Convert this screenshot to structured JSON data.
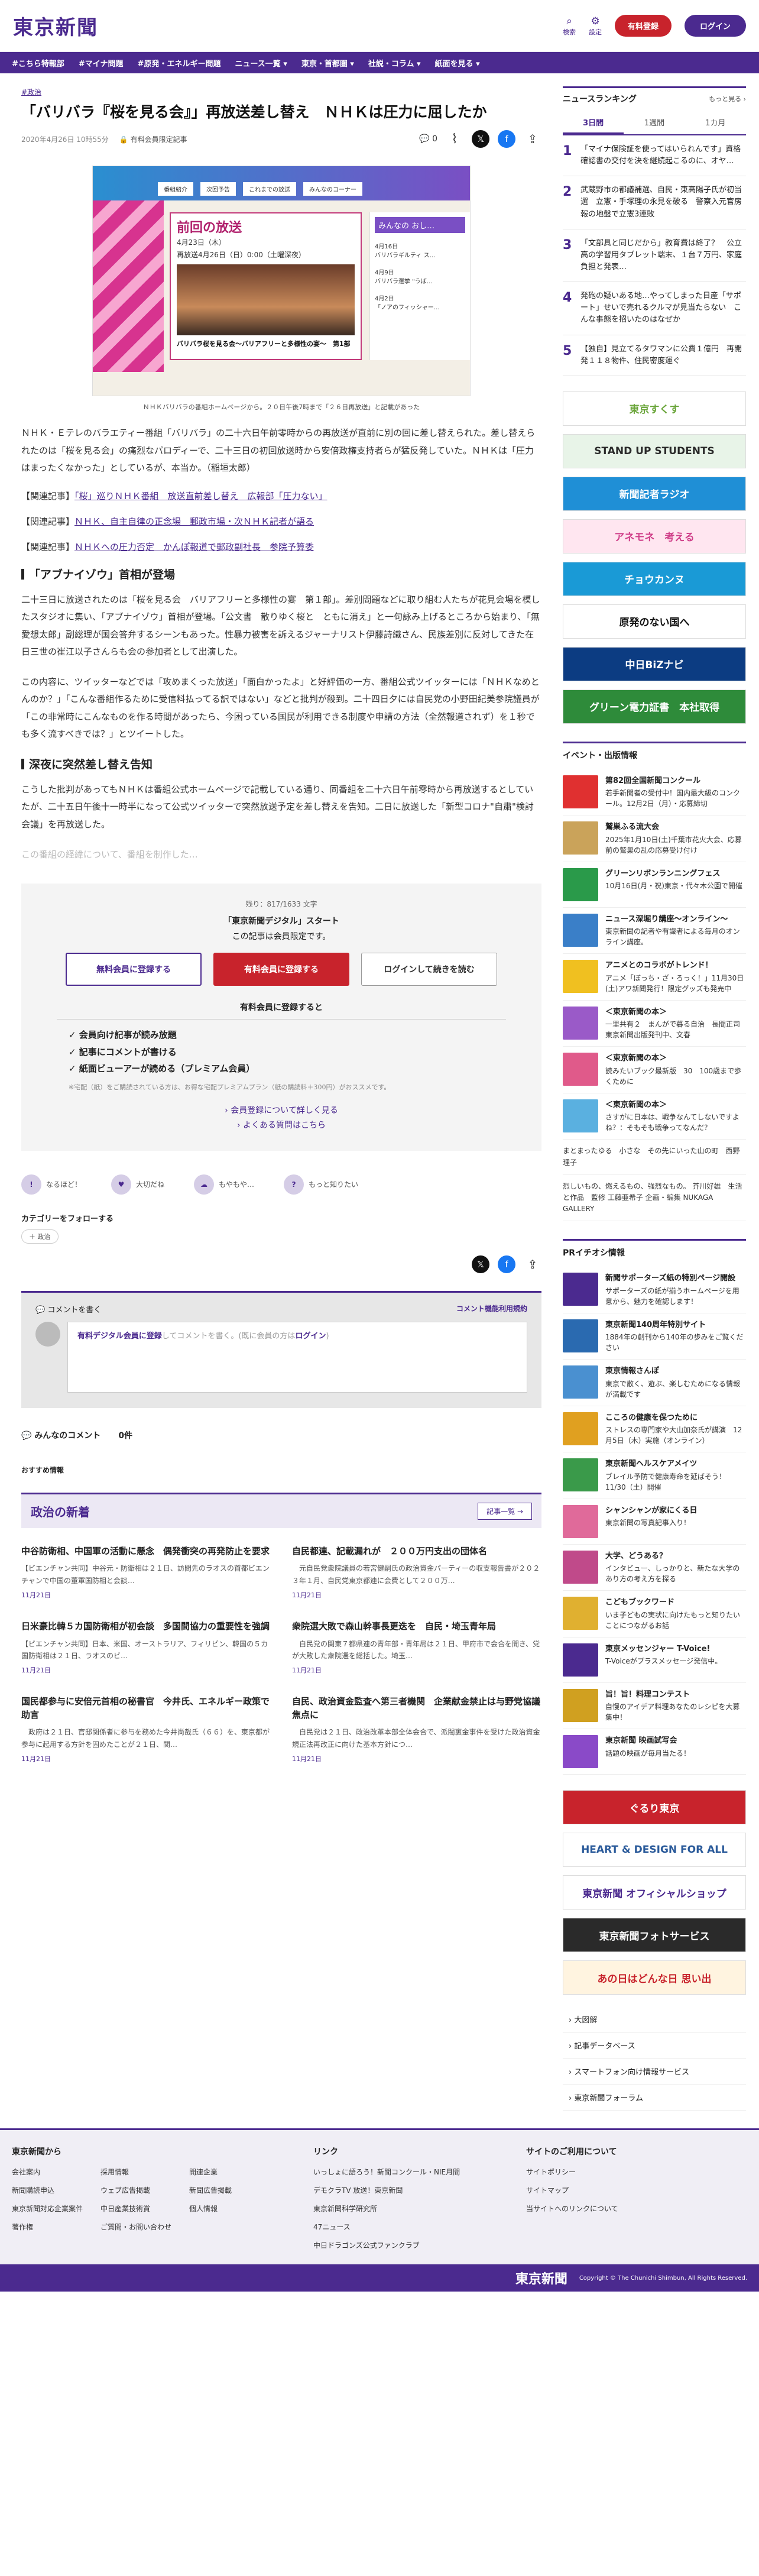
{
  "header": {
    "logo": "東京新聞",
    "search": "検索",
    "settings": "設定",
    "signup": "有料登録",
    "login": "ログイン"
  },
  "nav": [
    "#こちら特報部",
    "#マイナ問題",
    "#原発・エネルギー問題",
    "ニュース一覧 ▾",
    "東京・首都圏 ▾",
    "社説・コラム ▾",
    "紙面を見る ▾"
  ],
  "article": {
    "category": "#政治",
    "title": "「バリバラ『桜を見る会』」再放送差し替え　ＮＨＫは圧力に屈したか",
    "date": "2020年4月26日 10時55分",
    "paid_label": "有料会員限定記事",
    "comment_count": "0",
    "photo": {
      "tabs": [
        "番組紹介",
        "次回予告",
        "これまでの放送",
        "みんなのコーナー"
      ],
      "panel_title": "前回の放送",
      "panel_date": "再放送4月26日（日）0:00（土曜深夜）",
      "panel_date2": "4月23日（木）",
      "panel_caption": "バリバラ桜を見る会～バリアフリーと多様性の宴～　第1部",
      "list_head": "みんなの おし…",
      "list_items": [
        "4月16日\nバリバラギルティ ス…",
        "4月9日\nバリバラ選挙 \"うば…",
        "4月2日\n「ノアのフィッシャー…"
      ]
    },
    "photo_caption": "ＮＨＫバリバラの番組ホームページから。２０日午後7時まで「２６日再放送」と記載があった",
    "para1": "ＮＨＫ・Ｅテレのバラエティー番組「バリバラ」の二十六日午前零時からの再放送が直前に別の回に差し替えられた。差し替えられたのは「桜を見る会」の痛烈なパロディーで、二十三日の初回放送時から安倍政権支持者らが猛反発していた。ＮＨＫは「圧力はまったくなかった」としているが、本当か。（稲垣太郎）",
    "related": [
      {
        "label": "【関連記事】",
        "link": "「桜」巡りＮＨＫ番組　放送直前差し替え　広報部「圧力ない」"
      },
      {
        "label": "【関連記事】",
        "link": "ＮＨＫ、自主自律の正念場　郵政市場・次ＮＨＫ記者が語る"
      },
      {
        "label": "【関連記事】",
        "link": "ＮＨＫへの圧力否定　かんぽ報道で郵政副社長　参院予算委"
      }
    ],
    "h1": "「アブナイゾウ」首相が登場",
    "para2": "二十三日に放送されたのは「桜を見る会　バリアフリーと多様性の宴　第１部」。差別問題などに取り組む人たちが花見会場を模したスタジオに集い、「アブナイゾウ」首相が登場。「公文書　散りゆく桜と　ともに消え」と一句詠み上げるところから始まり、「無愛想太郎」副総理が国会答弁するシーンもあった。性暴力被害を訴えるジャーナリスト伊藤詩織さん、民族差別に反対してきた在日三世の崔江以子さんらも会の参加者として出演した。",
    "para3": "この内容に、ツイッターなどでは「攻めまくった放送」「面白かったよ」と好評価の一方、番組公式ツイッターには「ＮＨＫなめとんのか？」「こんな番組作るために受信料払ってる訳ではない」などと批判が殺到。二十四日夕には自民党の小野田紀美参院議員が「この非常時にこんなものを作る時間があったら、今困っている国民が利用できる制度や申請の方法（全然報道されず）を１秒でも多く流すべきでは？」とツイートした。",
    "h2": "深夜に突然差し替え告知",
    "para4": "こうした批判があってもＮＨＫは番組公式ホームページで記載している通り、同番組を二十六日午前零時から再放送するとしていたが、二十五日午後十一時半になって公式ツイッターで突然放送予定を差し替えを告知。二日に放送した「新型コロナ\"自粛\"検討会議」を再放送した。",
    "para5": "この番組の経緯について、番組を制作した…"
  },
  "paywall": {
    "count": "残り：817/1633 文字",
    "headline": "「東京新聞デジタル」スタート",
    "sub": "この記事は会員限定です。",
    "btn_free": "無料会員に登録する",
    "btn_paid": "有料会員に登録する",
    "btn_login": "ログインして続きを読む",
    "benefits_h": "有料会員に登録すると",
    "benefits": [
      "✓ 会員向け記事が読み放題",
      "✓ 記事にコメントが書ける",
      "✓ 紙面ビューアーが読める（プレミアム会員）"
    ],
    "note": "※宅配（紙）をご購読されている方は、お得な宅配プレミアムプラン（紙の購読料＋300円）がおススメです。",
    "link1": "会員登録について詳しく見る",
    "link2": "よくある質問はこちら"
  },
  "reactions": [
    "なるほど！",
    "大切だね",
    "もやもや…",
    "もっと知りたい"
  ],
  "follow": {
    "heading": "カテゴリーをフォローする",
    "chip": "＋ 政治"
  },
  "comment": {
    "heading": "コメントを書く",
    "rules": "コメント機能利用規約",
    "placeholder_pre": "有料デジタル会員に登録",
    "placeholder_mid": "してコメントを書く。(既に会員の方は",
    "placeholder_login": "ログイン",
    "placeholder_post": ")"
  },
  "all_comments": {
    "label": "みんなのコメント",
    "count": "0件"
  },
  "recommend": "おすすめ情報",
  "politics_news": {
    "heading": "政治の新着",
    "more": "記事一覧 →",
    "items": [
      {
        "h": "中谷防衛相、中国軍の活動に懸念　偶発衝突の再発防止を要求",
        "d": "【ビエンチャン共同】中谷元・防衛相は２１日、訪問先のラオスの首都ビエンチャンで中国の董軍国防相と会談…",
        "t": "11月21日"
      },
      {
        "h": "自民都連、記載漏れが　２００万円支出の団体名",
        "d": "　元自民党衆院議員の若宮健嗣氏の政治資金パーティーの収支報告書が２０２３年１月、自民党東京都連に会費として２００万…",
        "t": "11月21日"
      },
      {
        "h": "日米豪比韓５カ国防衛相が初会談　多国間協力の重要性を強調",
        "d": "【ビエンチャン共同】日本、米国、オーストラリア、フィリピン、韓国の５カ国防衛相は２１日、ラオスのビ…",
        "t": "11月21日"
      },
      {
        "h": "衆院選大敗で森山幹事長更迭を　自民・埼玉青年局",
        "d": "　自民党の関東７都県連の青年部・青年局は２１日、甲府市で会合を開き、党が大敗した衆院選を総括した。埼玉…",
        "t": "11月21日"
      },
      {
        "h": "国民都参与に安倍元首相の秘書官　今井氏、エネルギー政策で助言",
        "d": "　政府は２１日、官邸関係者に参与を務めた今井尚哉氏（６６）を、東京都が参与に起用する方針を固めたことが２１日、関…",
        "t": "11月21日"
      },
      {
        "h": "自民、政治資金監査へ第三者機関　企業献金禁止は与野党協議焦点に",
        "d": "　自民党は２１日、政治改革本部全体会合で、派閥裏金事件を受けた政治資金規正法再改正に向けた基本方針につ…",
        "t": "11月21日"
      }
    ]
  },
  "sidebar": {
    "ranking_h": "ニュースランキング",
    "ranking_more": "もっと見る ›",
    "tabs": [
      "3日間",
      "1週間",
      "1カ月"
    ],
    "ranking": [
      {
        "n": "1",
        "t": "「マイナ保険証を使ってはいられんです」資格確認書の交付を決を継続起こるのに、オヤ…"
      },
      {
        "n": "2",
        "t": "武蔵野市の都議補選、自民・東高陽子氏が初当選　立憲・手塚理の永見を破る　警察入元官房報の地盤で立憲3連敗"
      },
      {
        "n": "3",
        "t": "「文部具と同じだから」教育費は終了？　公立高の学習用タブレット端末、１台７万円、家庭負担と発表…"
      },
      {
        "n": "4",
        "t": "発砲の疑いある地…やってしまった日産「サポート」せいで売れるクルマが見当たらない　こんな事態を招いたのはなぜか"
      },
      {
        "n": "5",
        "t": "【独自】見立てるタワマンに公費１億円　再開発１１８物件、住民密度運ぐ"
      }
    ],
    "banners": [
      {
        "label": "東京すくす",
        "bg": "#ffffff",
        "fg": "#6aa53a"
      },
      {
        "label": "STAND UP STUDENTS",
        "bg": "#e8f4e8",
        "fg": "#2a2a2a"
      },
      {
        "label": "新聞記者ラジオ",
        "bg": "#1f8fd6",
        "fg": "#ffffff"
      },
      {
        "label": "アネモネ　考える",
        "bg": "#ffe6f0",
        "fg": "#d0408a"
      },
      {
        "label": "チョウカンヌ",
        "bg": "#1a9ad6",
        "fg": "#ffffff"
      },
      {
        "label": "原発のない国へ",
        "bg": "#ffffff",
        "fg": "#111111"
      },
      {
        "label": "中日BiZナビ",
        "bg": "#0c3c82",
        "fg": "#ffffff"
      },
      {
        "label": "グリーン電力証書　本社取得",
        "bg": "#2e8b3a",
        "fg": "#ffffff"
      }
    ],
    "events_h": "イベント・出版情報",
    "events": [
      {
        "b": "第82回全国新聞コンクール",
        "t": "若手新聞者の受付中！国内最大級のコンクール。12月2日（月）・応募締切",
        "c": "#e03030"
      },
      {
        "b": "鷲巣ふる流大会",
        "t": "2025年1月10日(土)千葉市花火大会、応募前の鷲巣の乱の応募受け付け",
        "c": "#caa35a"
      },
      {
        "b": "グリーンリボンランニングフェス",
        "t": "10月16日(月・祝)東京・代々木公園で開催",
        "c": "#2a9a4a"
      },
      {
        "b": "ニュース深堀り講座～オンライン～",
        "t": "東京新聞の記者や有識者による毎月のオンライン講座。",
        "c": "#3a7fc8"
      },
      {
        "b": "アニメとのコラボがトレンド！",
        "t": "アニメ「ぼっち・ざ・ろっく！」11月30日(土)アワ新聞発行！限定グッズも発売中",
        "c": "#f0c020"
      },
      {
        "b": "＜東京新聞の本＞",
        "t": "一里共有２　まんがで暮る自治　長間正司　東京新聞出版発刊中、文春",
        "c": "#9a5ac8"
      },
      {
        "b": "＜東京新聞の本＞",
        "t": "読みたいブック最新版　30　100歳まで歩くために",
        "c": "#e05a8a"
      },
      {
        "b": "＜東京新聞の本＞",
        "t": "さすがに日本は、戦争なんてしないですよね？：そもそも戦争ってなんだ？",
        "c": "#5ab0e0"
      }
    ],
    "events_plain": [
      "まとまったゆる　小さな　その先にいった山の町　西野理子",
      "烈しいもの、燃えるもの、強烈なもの。 芥川好雄　生活と作品　監修 工藤亜希子 企画・編集 NUKAGA GALLERY"
    ],
    "pr_h": "PRイチオシ情報",
    "pr": [
      {
        "b": "新聞サポーターズ紙の特別ページ開設",
        "t": "サポーターズの紙が揃うホームページを用意から、魅力を確認します！",
        "c": "#4b2a8f"
      },
      {
        "b": "東京新聞140周年特別サイト",
        "t": "1884年の創刊から140年の歩みをご覧ください",
        "c": "#2a6ab0"
      },
      {
        "b": "東京情報さんぽ",
        "t": "東京で散く、遊ぶ、楽しむためになる情報が満載です",
        "c": "#4a90d0"
      },
      {
        "b": "こころの健康を保つために",
        "t": "ストレスの専門家や大山加奈氏が講演　12月5日（木）実施（オンライン）",
        "c": "#e0a020"
      },
      {
        "b": "東京新聞ヘルスケアメイツ",
        "t": "ブレイル予防で健康寿命を延ばそう！　11/30（土）開催",
        "c": "#3a9a4a"
      },
      {
        "b": "シャンシャンが家にくる日",
        "t": "東京新聞の写真記事入り！",
        "c": "#e06a9a"
      },
      {
        "b": "大学、どうある？",
        "t": "インタビュー、しっかりと、新たな大学のあり方の考え方を探る",
        "c": "#c04a8a"
      },
      {
        "b": "こどもブックワード",
        "t": "いま子どもの実状に向けたもっと知りたいことにつながるお話",
        "c": "#e0b030"
      },
      {
        "b": "東京メッセンジャー T-Voice!",
        "t": "T-Voiceがプラスメッセージ発信中。",
        "c": "#4b2a8f"
      },
      {
        "b": "旨！旨！料理コンテスト",
        "t": "自慢のアイデア料理あなたのレシピを大募集中！",
        "c": "#d0a020"
      },
      {
        "b": "東京新聞 映画試写会",
        "t": "話題の映画が毎月当たる！",
        "c": "#8a4ac8"
      }
    ],
    "ad_banners": [
      {
        "label": "ぐるり東京",
        "bg": "#c8232c",
        "fg": "#ffffff"
      },
      {
        "label": "HEART & DESIGN FOR ALL",
        "bg": "#ffffff",
        "fg": "#2a5a9a"
      },
      {
        "label": "東京新聞 オフィシャルショップ",
        "bg": "#ffffff",
        "fg": "#4b2a8f"
      },
      {
        "label": "東京新聞フォトサービス",
        "bg": "#2a2a2a",
        "fg": "#ffffff"
      },
      {
        "label": "あの日はどんな日 思い出",
        "bg": "#fff4e0",
        "fg": "#c8232c"
      }
    ],
    "links": [
      "大図解",
      "記事データベース",
      "スマートフォン向け情報サービス",
      "東京新聞フォーラム"
    ]
  },
  "footer": {
    "col1_h": "東京新聞から",
    "col1": [
      "会社案内",
      "採用情報",
      "開連企業",
      "新聞購読申込",
      "ウェブ広告掲載",
      "新聞広告掲載",
      "東京新聞対応企業案件",
      "中日産業技術賞",
      "個人情報",
      "著作権",
      "ご質問・お問い合わせ"
    ],
    "col2_h": "リンク",
    "col2": [
      "いっしょに語ろう！新聞コンクール・NIE月間",
      "デモクラTV 放送！東京新聞",
      "東京新聞科学研究所",
      "47ニュース",
      "中日ドラゴンズ公式ファンクラブ"
    ],
    "col3_h": "サイトのご利用について",
    "col3": [
      "サイトポリシー",
      "サイトマップ",
      "当サイトへのリンクについて"
    ],
    "logo": "東京新聞",
    "copyright": "Copyright © The Chunichi Shimbun, All Rights Reserved."
  }
}
